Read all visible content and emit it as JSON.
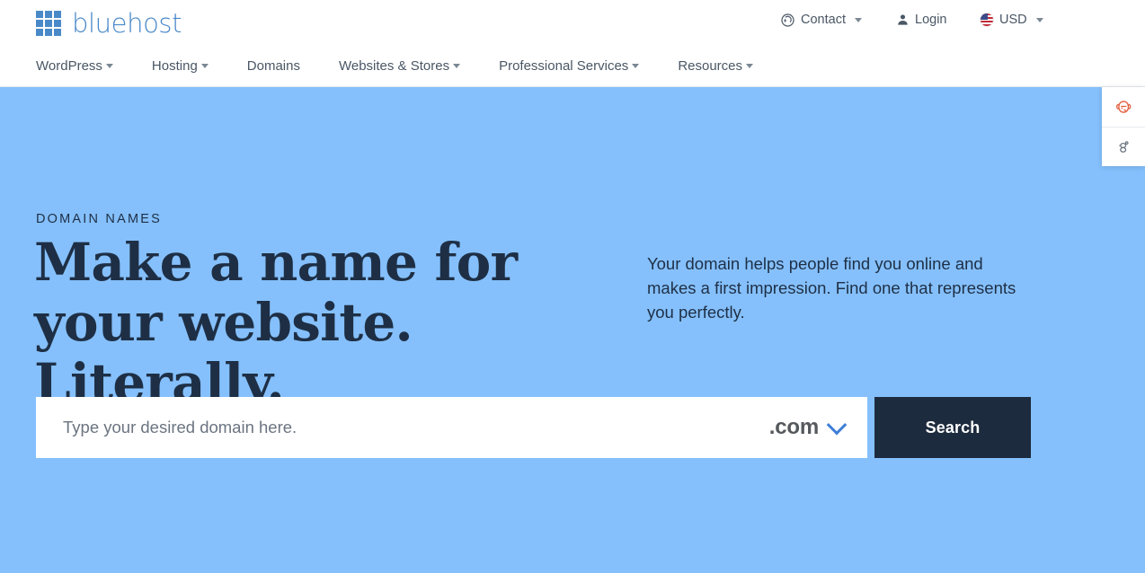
{
  "brand": {
    "name": "bluehost",
    "logo_icon": "grid-squares-logo-icon",
    "color": "#4a89c8"
  },
  "topbar": {
    "items": [
      {
        "label": "Contact",
        "icon": "headset-icon",
        "has_caret": true
      },
      {
        "label": "Login",
        "icon": "person-icon",
        "has_caret": false
      },
      {
        "label": "USD",
        "icon": "us-flag-icon",
        "has_caret": true
      }
    ]
  },
  "mainnav": {
    "items": [
      {
        "label": "WordPress",
        "has_caret": true
      },
      {
        "label": "Hosting",
        "has_caret": true
      },
      {
        "label": "Domains",
        "has_caret": false
      },
      {
        "label": "Websites & Stores",
        "has_caret": true
      },
      {
        "label": "Professional Services",
        "has_caret": true
      },
      {
        "label": "Resources",
        "has_caret": true
      }
    ]
  },
  "hero": {
    "eyebrow": "DOMAIN NAMES",
    "headline": "Make a name for your website. Literally.",
    "subcopy": "Your domain helps people find you online and makes a first impression. Find one that represents you perfectly.",
    "background_color": "#85c0fc",
    "text_color": "#1e2f45"
  },
  "search": {
    "placeholder": "Type your desired domain here.",
    "value": "",
    "tld_selected": ".com",
    "tld_caret_icon": "chevron-down-icon",
    "button_label": "Search",
    "button_color": "#1d2b3e"
  },
  "side_widget": {
    "buttons": [
      {
        "icon": "accessibility-face-icon",
        "color": "#e2603f"
      },
      {
        "icon": "cookie-settings-icon",
        "color": "#6b7480"
      }
    ]
  }
}
